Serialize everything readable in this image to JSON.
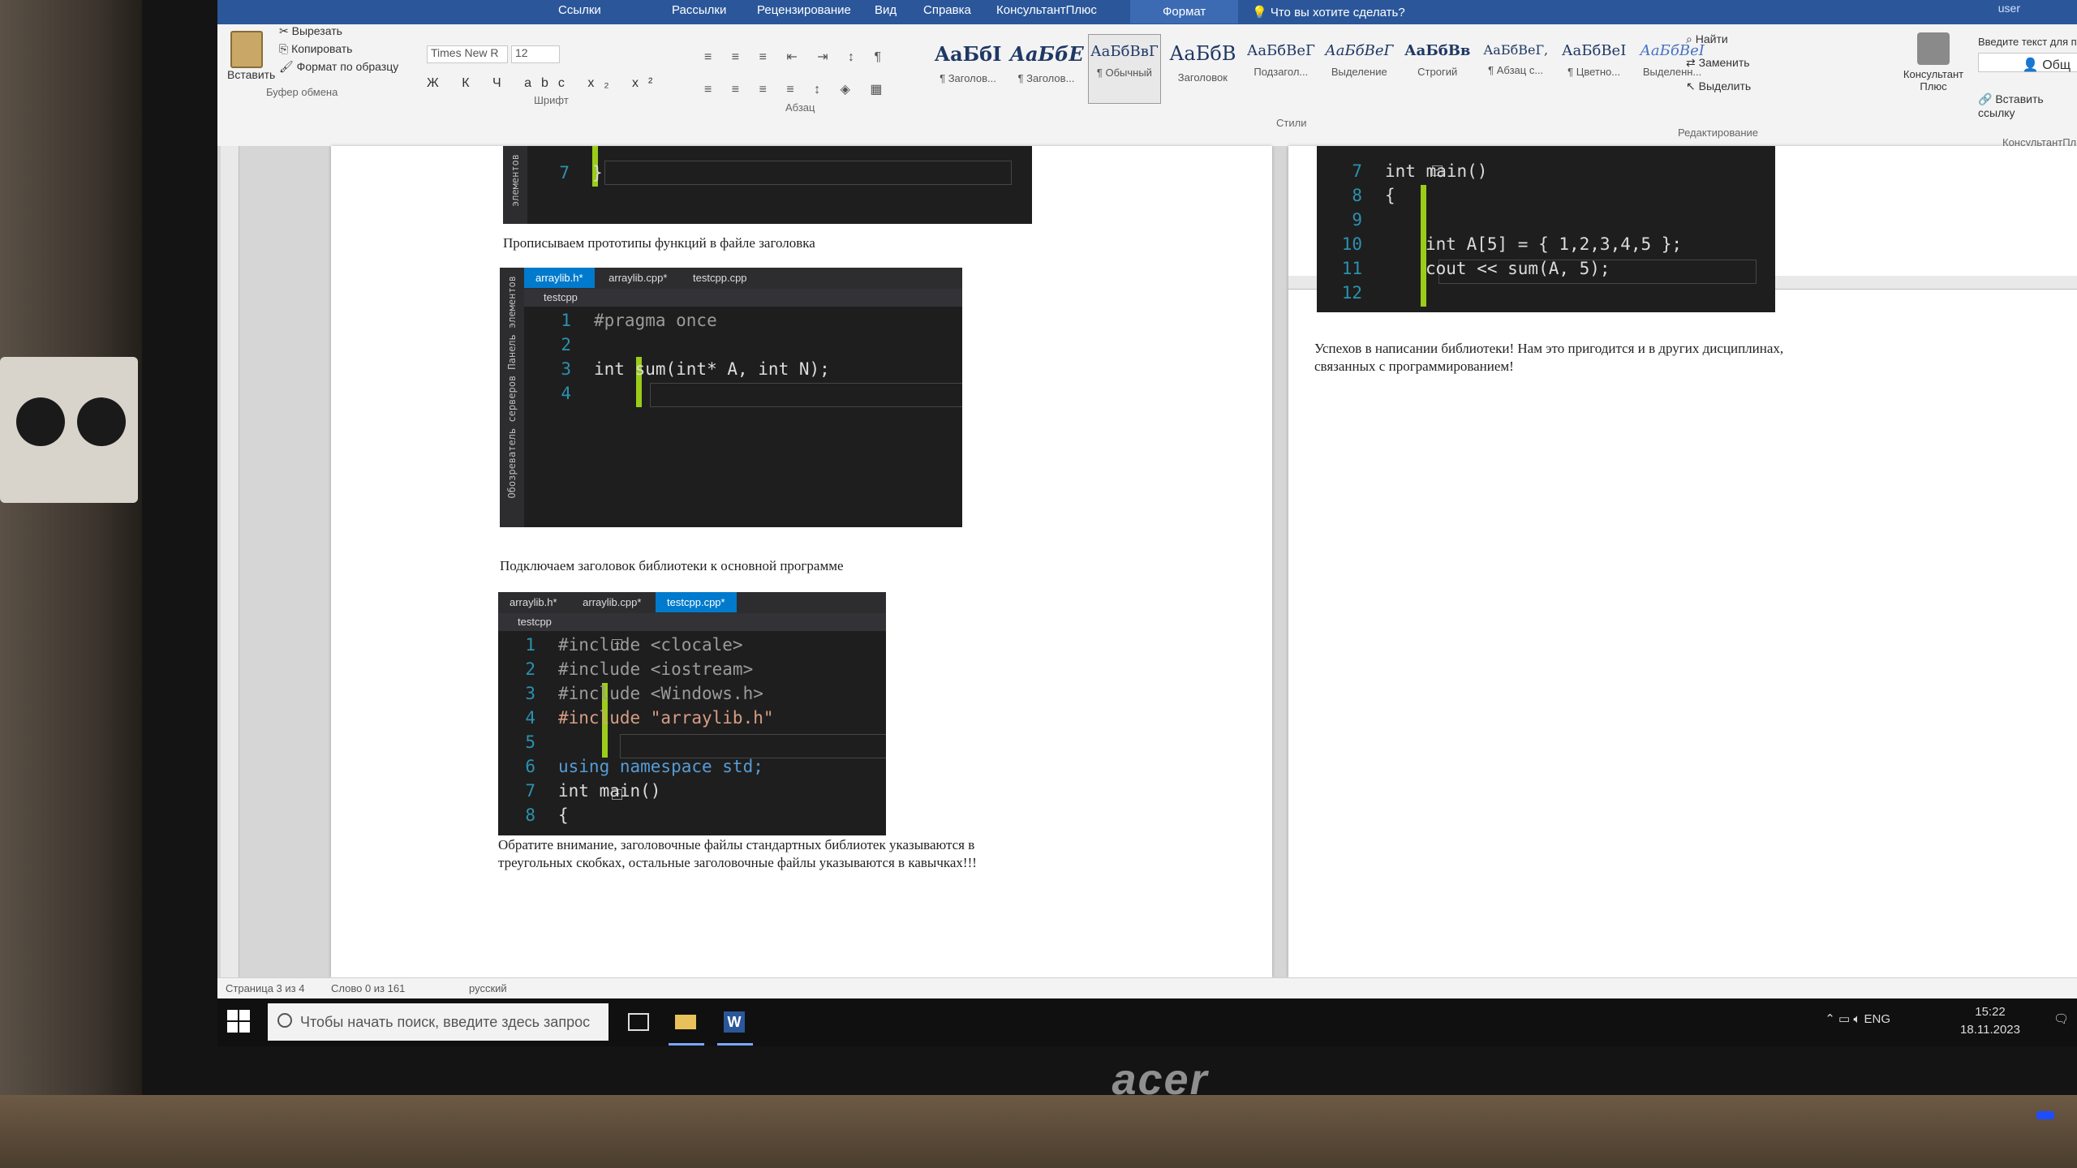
{
  "window": {
    "tabs": [
      "Ссылки",
      "Рассылки",
      "Рецензирование",
      "Вид",
      "Справка",
      "КонсультантПлюс",
      "Формат"
    ],
    "tell_me": "Что вы хотите сделать?",
    "user": "user",
    "share": "Общ"
  },
  "ribbon": {
    "clipboard": {
      "paste": "Вставить",
      "cut": "Вырезать",
      "copy": "Копировать",
      "format_painter": "Формат по образцу",
      "group": "Буфер обмена"
    },
    "font": {
      "name": "Times New R",
      "size": "12",
      "format_buttons": "Ж К Ч abc x₂ x²",
      "group": "Шрифт"
    },
    "paragraph": {
      "row1": "≡ ≡ ≡ ⇤ ⇥ ↕ ¶",
      "row2": "≡ ≡ ≡ ≡ ↕ ◈ ▦",
      "group": "Абзац"
    },
    "styles": {
      "items": [
        {
          "sample": "АаБбI",
          "name": "¶ Заголов..."
        },
        {
          "sample": "АаБбЕ",
          "name": "¶ Заголов..."
        },
        {
          "sample": "АаБбВвГ",
          "name": "¶ Обычный"
        },
        {
          "sample": "АаБбВ",
          "name": "Заголовок"
        },
        {
          "sample": "АаБбВеГ",
          "name": "Подзагол..."
        },
        {
          "sample": "АаБбВеГ",
          "name": "Выделение"
        },
        {
          "sample": "АаБбВв",
          "name": "Строгий"
        },
        {
          "sample": "АаБбВеГ,",
          "name": "¶ Абзац с..."
        },
        {
          "sample": "АаБбВеІ",
          "name": "¶ Цветно..."
        },
        {
          "sample": "АаБбВеІ",
          "name": "Выделенн..."
        }
      ],
      "group": "Стили"
    },
    "editing": {
      "find": "Найти",
      "replace": "Заменить",
      "select": "Выделить",
      "group": "Редактирование"
    },
    "konsultant": {
      "button": "Консультант Плюс",
      "search_placeholder": "Введите текст для поиска:",
      "insert_link": "Вставить ссылку",
      "group": "КонсультантПлюс"
    }
  },
  "document": {
    "heading_prototypes": "Прописываем прототипы функций в файле заголовка",
    "heading_include": "Подключаем заголовок библиотеки к основной программе",
    "note_line1": "Обратите внимание, заголовочные файлы стандартных библиотек указываются в",
    "note_line2": "треугольных скобках, остальные заголовочные файлы указываются в кавычках!!!",
    "success_line1": "Успехов в написании библиотеки! Нам это пригодится и в других дисциплинах,",
    "success_line2": "связанных с программированием!",
    "shot0": {
      "side": "элементов",
      "lines": [
        {
          "n": "7",
          "code": "}"
        }
      ]
    },
    "shot1": {
      "side": "Обозреватель серверов   Панель элементов",
      "tabs": [
        "arraylib.h*",
        "arraylib.cpp*",
        "testcpp.cpp"
      ],
      "nav": "testcpp",
      "lines": [
        {
          "n": "1",
          "code": "#pragma once"
        },
        {
          "n": "2",
          "code": ""
        },
        {
          "n": "3",
          "code": "int sum(int* A, int N);"
        },
        {
          "n": "4",
          "code": ""
        }
      ]
    },
    "shot2": {
      "tabs": [
        "arraylib.h*",
        "arraylib.cpp*",
        "testcpp.cpp*"
      ],
      "nav": "testcpp",
      "lines": [
        {
          "n": "1",
          "code": "#include <clocale>"
        },
        {
          "n": "2",
          "code": "#include <iostream>"
        },
        {
          "n": "3",
          "code": "#include <Windows.h>"
        },
        {
          "n": "4",
          "code": "#include \"arraylib.h\""
        },
        {
          "n": "5",
          "code": ""
        },
        {
          "n": "6",
          "code": "using namespace std;"
        },
        {
          "n": "7",
          "code": "int main()"
        },
        {
          "n": "8",
          "code": "{"
        }
      ]
    },
    "shot3": {
      "lines": [
        {
          "n": "7",
          "code": "int main()"
        },
        {
          "n": "8",
          "code": "{"
        },
        {
          "n": "9",
          "code": ""
        },
        {
          "n": "10",
          "code": "int A[5] = { 1,2,3,4,5 };"
        },
        {
          "n": "11",
          "code": "cout << sum(A, 5);"
        },
        {
          "n": "12",
          "code": ""
        }
      ]
    }
  },
  "statusbar": {
    "page": "Страница 3 из 4",
    "words": "Слово 0 из 161",
    "lang": "русский"
  },
  "taskbar": {
    "search_placeholder": "Чтобы начать поиск, введите здесь запрос",
    "lang": "ENG",
    "time": "15:22",
    "date": "18.11.2023"
  },
  "monitor": {
    "brand": "acer"
  },
  "colors": {
    "ribbon_blue": "#2b579a",
    "vs_bg": "#1e1e1e",
    "vs_keyword": "#569cd6",
    "vs_string": "#d69d85",
    "vs_linenum": "#2b91af",
    "vs_change": "#9ccc1a"
  }
}
